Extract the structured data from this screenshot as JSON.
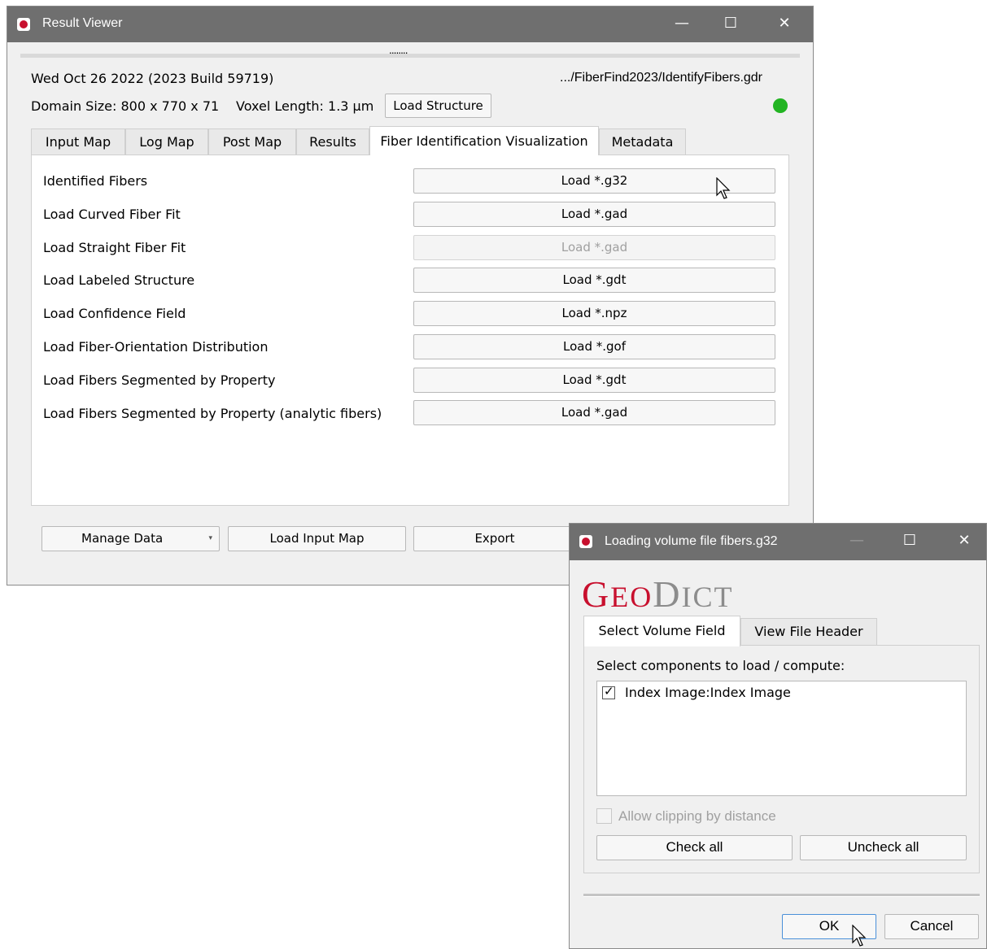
{
  "result_viewer": {
    "title": "Result Viewer",
    "controls": {
      "minimize": "—",
      "maximize": "☐",
      "close": "✕"
    },
    "splitter": "........",
    "date_build": "Wed Oct 26 2022 (2023 Build 59719)",
    "file_path": ".../FiberFind2023/IdentifyFibers.gdr",
    "domain_size": "Domain Size: 800 x 770 x 71",
    "voxel_length": "Voxel Length: 1.3 µm",
    "load_structure_label": "Load Structure",
    "status_color": "#22b422",
    "tabs": [
      "Input Map",
      "Log Map",
      "Post Map",
      "Results",
      "Fiber Identification Visualization",
      "Metadata"
    ],
    "active_tab": "Fiber Identification Visualization",
    "rows": [
      {
        "label": "Identified Fibers",
        "button": "Load *.g32",
        "enabled": true
      },
      {
        "label": "Load Curved Fiber Fit",
        "button": "Load *.gad",
        "enabled": true
      },
      {
        "label": "Load Straight Fiber Fit",
        "button": "Load *.gad",
        "enabled": false
      },
      {
        "label": "Load Labeled Structure",
        "button": "Load *.gdt",
        "enabled": true
      },
      {
        "label": "Load Confidence Field",
        "button": "Load *.npz",
        "enabled": true
      },
      {
        "label": "Load Fiber-Orientation Distribution",
        "button": "Load *.gof",
        "enabled": true
      },
      {
        "label": "Load Fibers Segmented by Property",
        "button": "Load *.gdt",
        "enabled": true
      },
      {
        "label": "Load Fibers Segmented by Property (analytic fibers)",
        "button": "Load *.gad",
        "enabled": true
      }
    ],
    "bottom_buttons": {
      "manage_data": "Manage Data",
      "load_input_map": "Load Input Map",
      "export": "Export"
    }
  },
  "loading_dialog": {
    "title": "Loading volume file fibers.g32",
    "controls": {
      "minimize": "—",
      "maximize": "☐",
      "close": "✕"
    },
    "logo": {
      "geo_g": "G",
      "geo_rest": "EO",
      "dict_d": "D",
      "dict_rest": "ICT"
    },
    "brand_color": "#c8102e",
    "tabs": [
      "Select Volume Field",
      "View File Header"
    ],
    "active_tab": "Select Volume Field",
    "instruction": "Select components to load / compute:",
    "components": [
      {
        "label": "Index Image:Index Image",
        "checked": true
      }
    ],
    "allow_clipping": {
      "label": "Allow clipping by distance",
      "checked": false,
      "enabled": false
    },
    "check_all": "Check all",
    "uncheck_all": "Uncheck all",
    "ok": "OK",
    "cancel": "Cancel"
  }
}
